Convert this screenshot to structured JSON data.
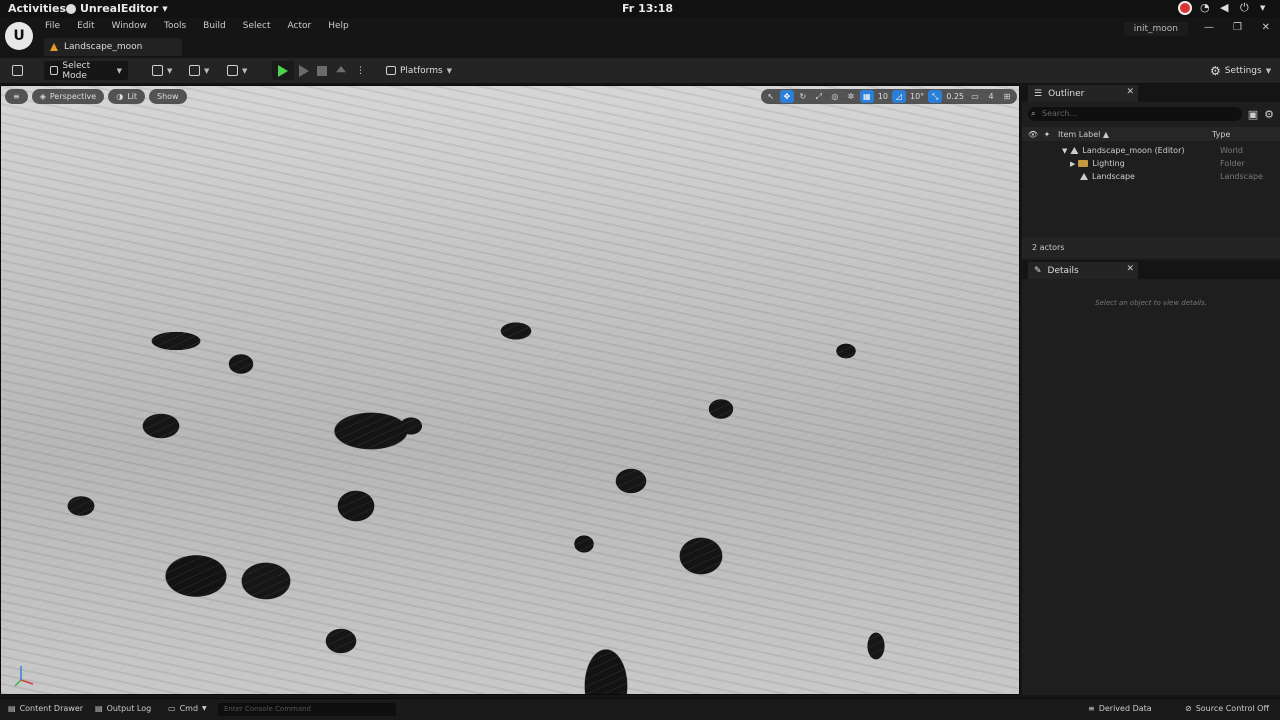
{
  "system_bar": {
    "activities": "Activities",
    "app_name": "UnrealEditor",
    "clock": "Fr 13:18"
  },
  "menubar": {
    "logo": "U",
    "items": [
      "File",
      "Edit",
      "Window",
      "Tools",
      "Build",
      "Select",
      "Actor",
      "Help"
    ],
    "level_tab": "Landscape_moon",
    "project": "init_moon"
  },
  "toolbar": {
    "select_mode": "Select Mode",
    "platforms": "Platforms",
    "settings": "Settings"
  },
  "viewport": {
    "perspective": "Perspective",
    "lit": "Lit",
    "show": "Show",
    "grid_snap": "10",
    "rotation_snap": "10°",
    "scale_snap": "0.25",
    "camera_speed": "4"
  },
  "outliner": {
    "title": "Outliner",
    "search_placeholder": "Search...",
    "col_label": "Item Label ▲",
    "col_type": "Type",
    "rows": [
      {
        "label": "Landscape_moon (Editor)",
        "type": "World"
      },
      {
        "label": "Lighting",
        "type": "Folder"
      },
      {
        "label": "Landscape",
        "type": "Landscape"
      }
    ],
    "actor_count": "2 actors"
  },
  "details": {
    "title": "Details",
    "hint": "Select an object to view details."
  },
  "statusbar": {
    "content_drawer": "Content Drawer",
    "output_log": "Output Log",
    "cmd": "Cmd",
    "console_placeholder": "Enter Console Command",
    "derived_data": "Derived Data",
    "source_control": "Source Control Off"
  }
}
